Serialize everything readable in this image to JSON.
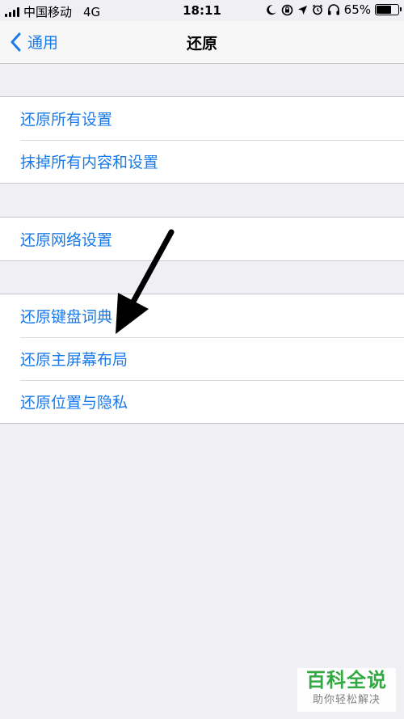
{
  "status": {
    "carrier": "中国移动",
    "network": "4G",
    "time": "18:11",
    "battery": "65%",
    "battery_level": 0.65
  },
  "nav": {
    "back_label": "通用",
    "title": "还原"
  },
  "groups": [
    {
      "items": [
        {
          "label": "还原所有设置"
        },
        {
          "label": "抹掉所有内容和设置"
        }
      ]
    },
    {
      "items": [
        {
          "label": "还原网络设置"
        }
      ]
    },
    {
      "items": [
        {
          "label": "还原键盘词典"
        },
        {
          "label": "还原主屏幕布局"
        },
        {
          "label": "还原位置与隐私"
        }
      ]
    }
  ],
  "watermark": {
    "title": "百科全说",
    "subtitle": "助你轻松解决"
  },
  "colors": {
    "accent": "#1a7ae8",
    "background": "#efeff4",
    "watermark": "#2aa53a"
  }
}
